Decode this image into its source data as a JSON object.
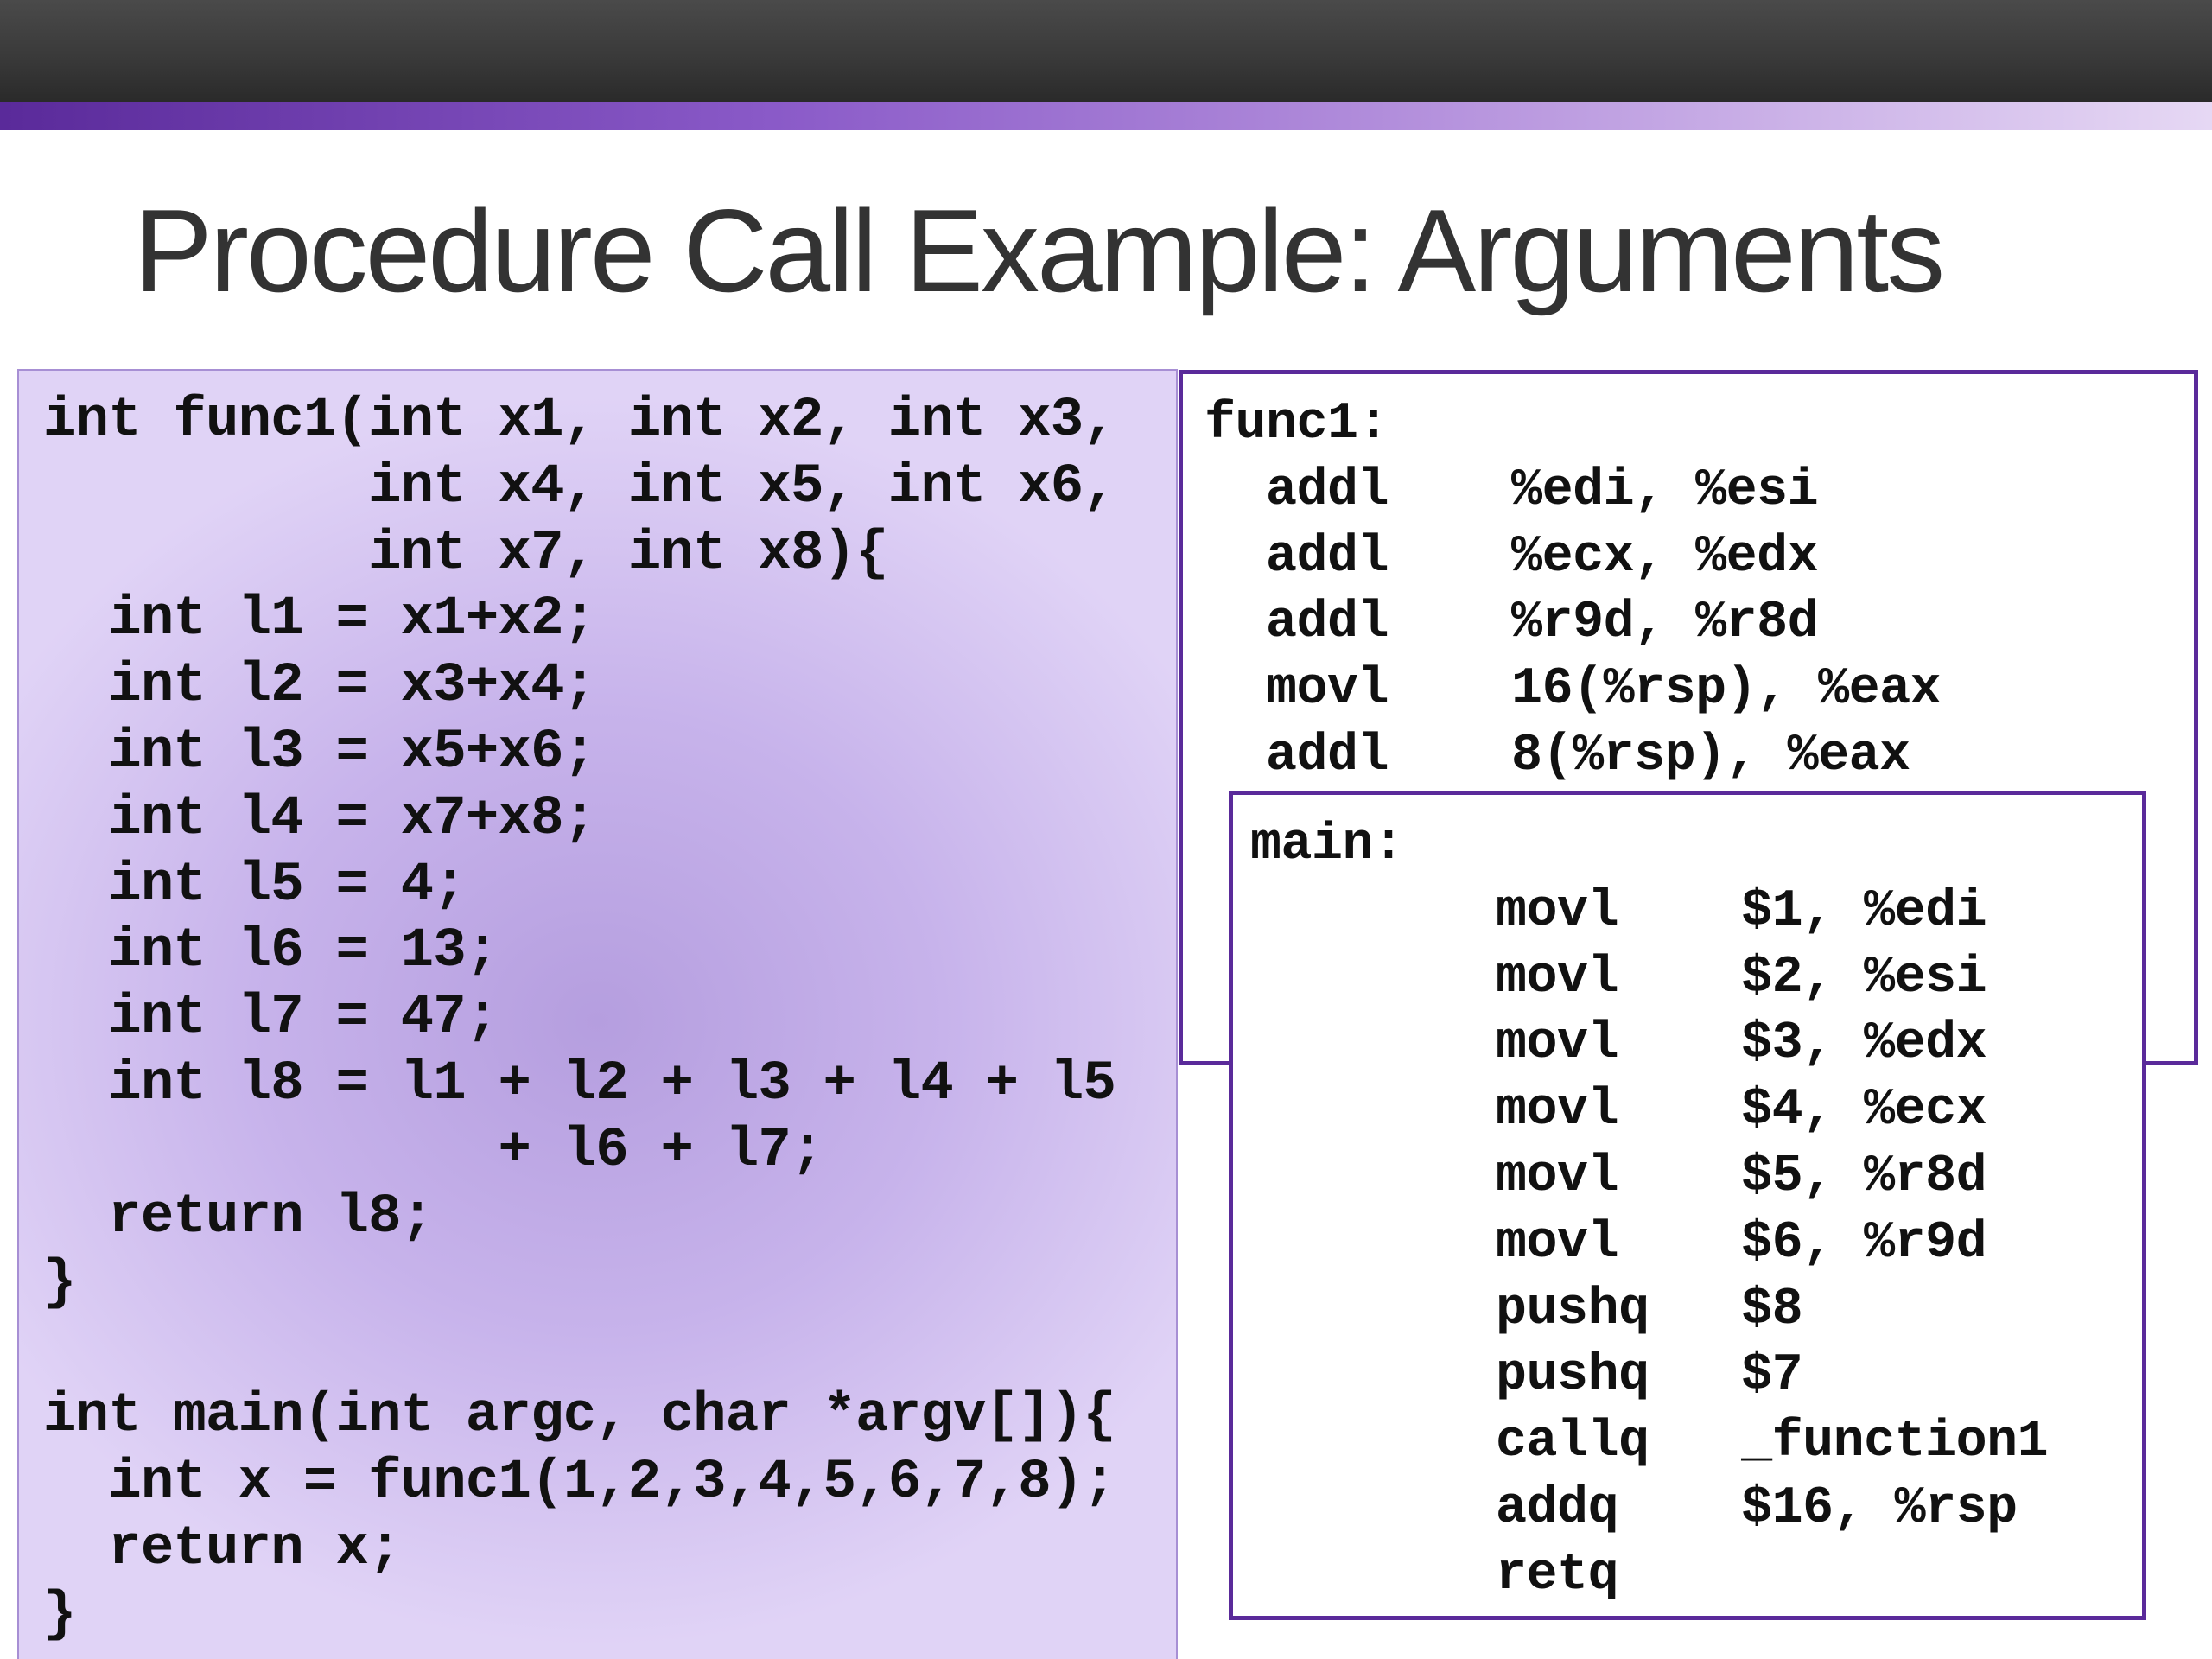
{
  "slide": {
    "title": "Procedure Call Example: Arguments",
    "accent_color": "#5a2a9a",
    "panel_color": "#c7b3eb"
  },
  "c_source": {
    "code": "int func1(int x1, int x2, int x3,\n          int x4, int x5, int x6,\n          int x7, int x8){\n  int l1 = x1+x2;\n  int l2 = x3+x4;\n  int l3 = x5+x6;\n  int l4 = x7+x8;\n  int l5 = 4;\n  int l6 = 13;\n  int l7 = 47;\n  int l8 = l1 + l2 + l3 + l4 + l5\n              + l6 + l7;\n  return l8;\n}\n\nint main(int argc, char *argv[]){\n  int x = func1(1,2,3,4,5,6,7,8);\n  return x;\n}"
  },
  "asm_func1": {
    "code": "func1:\n  addl    %edi, %esi\n  addl    %ecx, %edx\n  addl    %r9d, %r8d\n  movl    16(%rsp), %eax\n  addl    8(%rsp), %eax"
  },
  "asm_main": {
    "code": "main:\n        movl    $1, %edi\n        movl    $2, %esi\n        movl    $3, %edx\n        movl    $4, %ecx\n        movl    $5, %r8d\n        movl    $6, %r9d\n        pushq   $8\n        pushq   $7\n        callq   _function1\n        addq    $16, %rsp\n        retq"
  }
}
